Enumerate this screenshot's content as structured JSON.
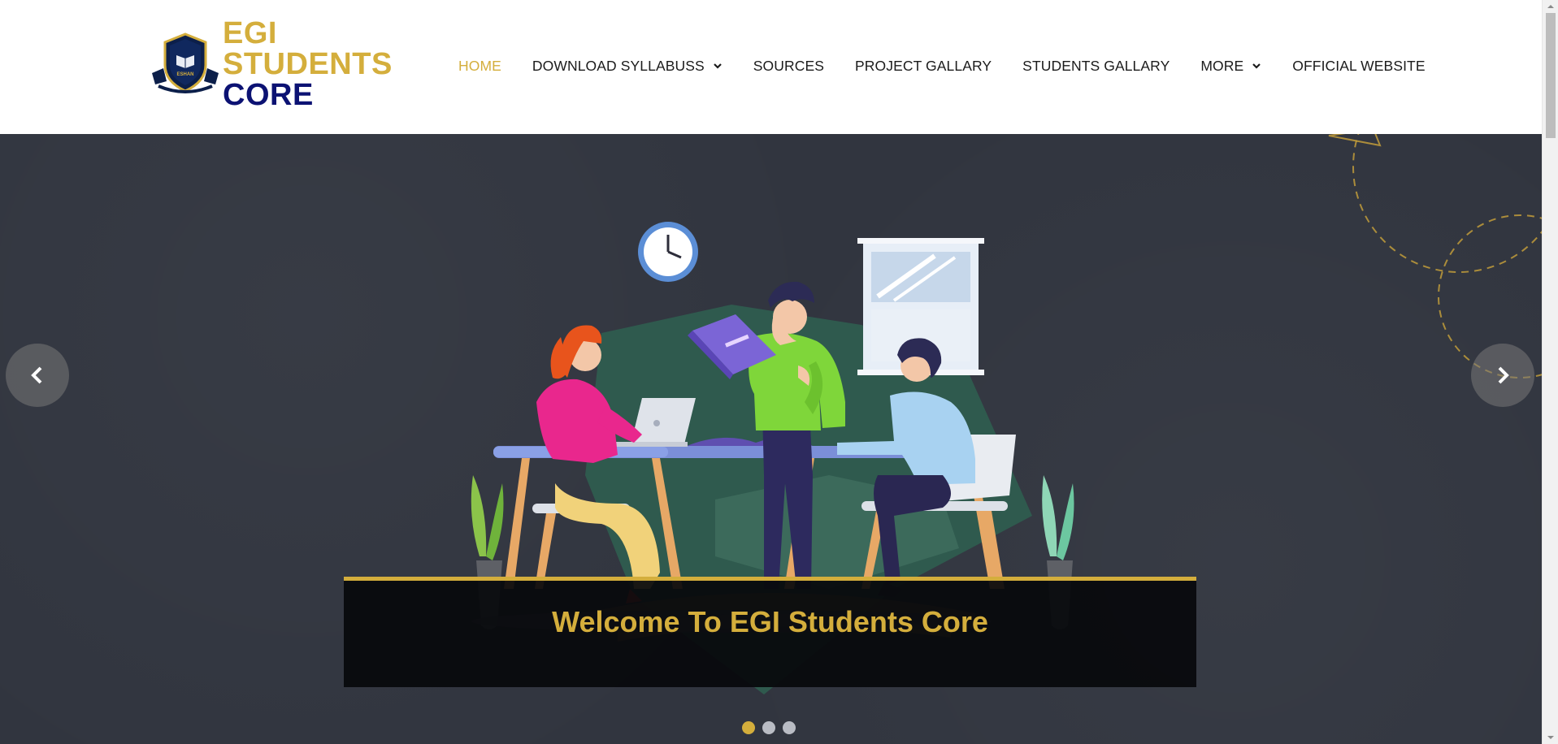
{
  "brand": {
    "line1": "EGI",
    "line2": "STUDENTS",
    "line3": "CORE",
    "emblem_text": "ESHAN",
    "colors": {
      "gold": "#d4ae3c",
      "navy": "#0c1273"
    }
  },
  "nav": {
    "items": [
      {
        "label": "HOME",
        "active": true,
        "has_dropdown": false
      },
      {
        "label": "DOWNLOAD SYLLABUSS",
        "active": false,
        "has_dropdown": true
      },
      {
        "label": "SOURCES",
        "active": false,
        "has_dropdown": false
      },
      {
        "label": "PROJECT GALLARY",
        "active": false,
        "has_dropdown": false
      },
      {
        "label": "STUDENTS GALLARY",
        "active": false,
        "has_dropdown": false
      },
      {
        "label": "MORE",
        "active": false,
        "has_dropdown": true
      },
      {
        "label": "OFFICIAL WEBSITE",
        "active": false,
        "has_dropdown": false
      }
    ]
  },
  "hero": {
    "caption": "Welcome To EGI Students Core",
    "slides": 3,
    "active_slide": 1,
    "prev_icon": "chevron-left-icon",
    "next_icon": "chevron-right-icon",
    "background": "#31353f"
  }
}
